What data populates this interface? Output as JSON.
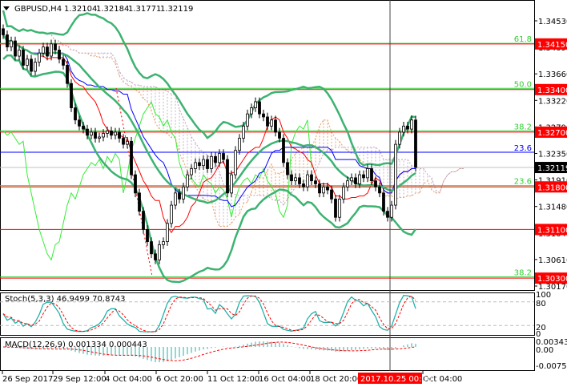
{
  "chart_data": {
    "type": "candlestick",
    "symbol_title": "GBPUSD,H4",
    "ohlc_header": [
      "1.32104",
      "1.32184",
      "1.31771",
      "1.32119"
    ],
    "current_price": 1.32119,
    "current_price_label": "1.32119",
    "ylim": [
      1.301,
      1.347
    ],
    "price_ticks": [
      "1.34530",
      "1.34090",
      "1.33660",
      "1.33220",
      "1.32790",
      "1.32350",
      "1.31910",
      "1.31480",
      "1.31040",
      "1.30610",
      "1.30170"
    ],
    "levels": [
      {
        "price": 1.3415,
        "label": "1.34150",
        "color": "#ff0000"
      },
      {
        "price": 1.334,
        "label": "1.33400",
        "color": "#ff0000"
      },
      {
        "price": 1.327,
        "label": "1.32700",
        "color": "#ff0000"
      },
      {
        "price": 1.318,
        "label": "1.31800",
        "color": "#ff0000"
      },
      {
        "price": 1.311,
        "label": "1.31100",
        "color": "#ff0000"
      },
      {
        "price": 1.303,
        "label": "1.30300",
        "color": "#ff0000"
      }
    ],
    "fibo": [
      {
        "price": 1.3416,
        "label": "61.8",
        "color": "#33cc33"
      },
      {
        "price": 1.3342,
        "label": "50.0",
        "color": "#33cc33"
      },
      {
        "price": 1.3272,
        "label": "38.2",
        "color": "#33cc33"
      },
      {
        "price": 1.3237,
        "label": "23.6",
        "color": "#0000ff"
      },
      {
        "price": 1.3182,
        "label": "23.6",
        "color": "#33cc33"
      },
      {
        "price": 1.3032,
        "label": "38.2",
        "color": "#33cc33"
      }
    ],
    "closes": [
      1.343,
      1.341,
      1.342,
      1.3395,
      1.3405,
      1.338,
      1.339,
      1.337,
      1.3385,
      1.34,
      1.341,
      1.3395,
      1.3415,
      1.3405,
      1.339,
      1.338,
      1.335,
      1.331,
      1.329,
      1.328,
      1.3275,
      1.3265,
      1.327,
      1.326,
      1.3262,
      1.3268,
      1.3272,
      1.3265,
      1.327,
      1.326,
      1.325,
      1.3255,
      1.32,
      1.317,
      1.314,
      1.311,
      1.309,
      1.307,
      1.306,
      1.3085,
      1.309,
      1.312,
      1.315,
      1.317,
      1.316,
      1.318,
      1.32,
      1.321,
      1.322,
      1.3215,
      1.3225,
      1.321,
      1.323,
      1.322,
      1.3235,
      1.3225,
      1.317,
      1.32,
      1.324,
      1.326,
      1.328,
      1.33,
      1.331,
      1.332,
      1.33,
      1.3295,
      1.328,
      1.329,
      1.327,
      1.326,
      1.322,
      1.32,
      1.319,
      1.3195,
      1.3185,
      1.318,
      1.32,
      1.319,
      1.3185,
      1.317,
      1.318,
      1.3175,
      1.316,
      1.313,
      1.316,
      1.318,
      1.319,
      1.3195,
      1.3185,
      1.32,
      1.3195,
      1.321,
      1.319,
      1.318,
      1.317,
      1.314,
      1.313,
      1.315,
      1.325,
      1.327,
      1.328,
      1.3275,
      1.329,
      1.3212
    ],
    "time_labels": [
      "26 Sep 2017",
      "29 Sep 12:00",
      "4 Oct 04:00",
      "6 Oct 20:00",
      "11 Oct 12:00",
      "16 Oct 04:00",
      "18 Oct 20:00",
      "Oct 04:00"
    ],
    "crosshair_time": "2017.10.25 00:00",
    "stoch": {
      "label": "Stoch(5,3,3) 46.9499 70.8743",
      "ticks": [
        "100",
        "80",
        "20",
        "0"
      ]
    },
    "macd": {
      "label": "MACD(12,26,9) 0.001334 0.000443",
      "ticks": [
        "0.003439",
        "0.00",
        "-0.007566"
      ]
    },
    "colors": {
      "bollinger": "#3cb371",
      "fast_ma": "#ff0000",
      "slow_ma": "#0000ff",
      "chikou": "#33ee33",
      "label_bg": "#ff0000",
      "macd_hist": "#20b2aa"
    }
  }
}
